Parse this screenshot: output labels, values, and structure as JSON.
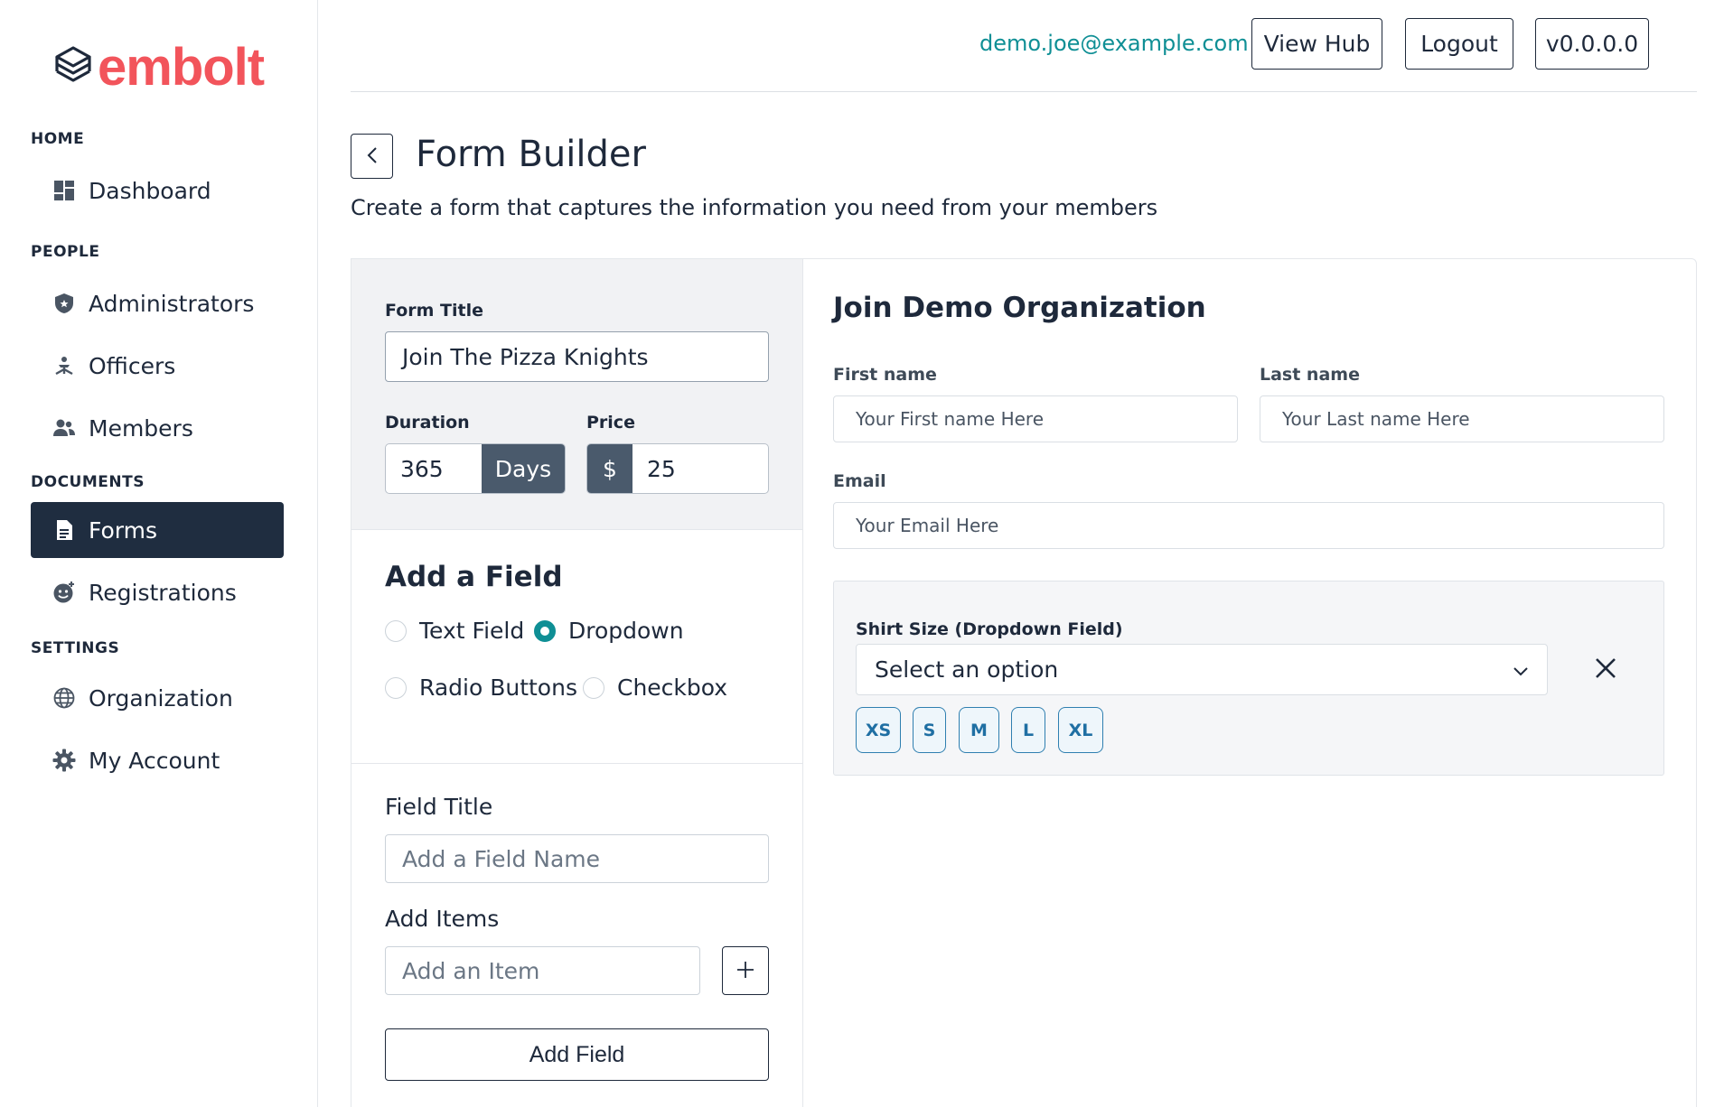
{
  "brand": {
    "logo_text": "embolt",
    "logo_icon": "stacked-layers-icon",
    "accent": "#f2545b"
  },
  "sidebar": {
    "sections": [
      {
        "label": "HOME"
      },
      {
        "label": "PEOPLE"
      },
      {
        "label": "DOCUMENTS"
      },
      {
        "label": "SETTINGS"
      }
    ],
    "items": [
      {
        "label": "Dashboard",
        "icon": "dashboard-icon"
      },
      {
        "label": "Administrators",
        "icon": "shield-icon"
      },
      {
        "label": "Officers",
        "icon": "officer-icon"
      },
      {
        "label": "Members",
        "icon": "members-icon"
      },
      {
        "label": "Forms",
        "icon": "document-icon",
        "active": true
      },
      {
        "label": "Registrations",
        "icon": "registration-icon"
      },
      {
        "label": "Organization",
        "icon": "globe-icon"
      },
      {
        "label": "My Account",
        "icon": "gear-icon"
      }
    ],
    "active_color": "#1f2d40"
  },
  "topbar": {
    "email": "demo.joe@example.com",
    "view_hub_label": "View Hub",
    "logout_label": "Logout",
    "version_label": "v0.0.0.0"
  },
  "header": {
    "title": "Form Builder",
    "subtitle": "Create a form that captures the information you need from your members"
  },
  "builder": {
    "form_title_label": "Form Title",
    "form_title_value": "Join The Pizza Knights",
    "duration_label": "Duration",
    "duration_value": "365",
    "duration_unit": "Days",
    "price_label": "Price",
    "price_currency": "$",
    "price_value": "25",
    "add_field_title": "Add a Field",
    "field_types": [
      {
        "label": "Text Field",
        "checked": false
      },
      {
        "label": "Dropdown",
        "checked": true
      },
      {
        "label": "Radio Buttons",
        "checked": false
      },
      {
        "label": "Checkbox",
        "checked": false
      }
    ],
    "field_title_label": "Field Title",
    "field_title_placeholder": "Add a Field Name",
    "add_items_label": "Add Items",
    "add_item_placeholder": "Add an Item",
    "add_field_button": "Add Field"
  },
  "preview": {
    "title": "Join Demo Organization",
    "first_name_label": "First name",
    "first_name_placeholder": "Your First name Here",
    "last_name_label": "Last name",
    "last_name_placeholder": "Your Last name Here",
    "email_label": "Email",
    "email_placeholder": "Your Email Here",
    "dropdown_field": {
      "label": "Shirt Size (Dropdown Field)",
      "selected": "Select an option",
      "options": [
        "XS",
        "S",
        "M",
        "L",
        "XL"
      ]
    }
  }
}
